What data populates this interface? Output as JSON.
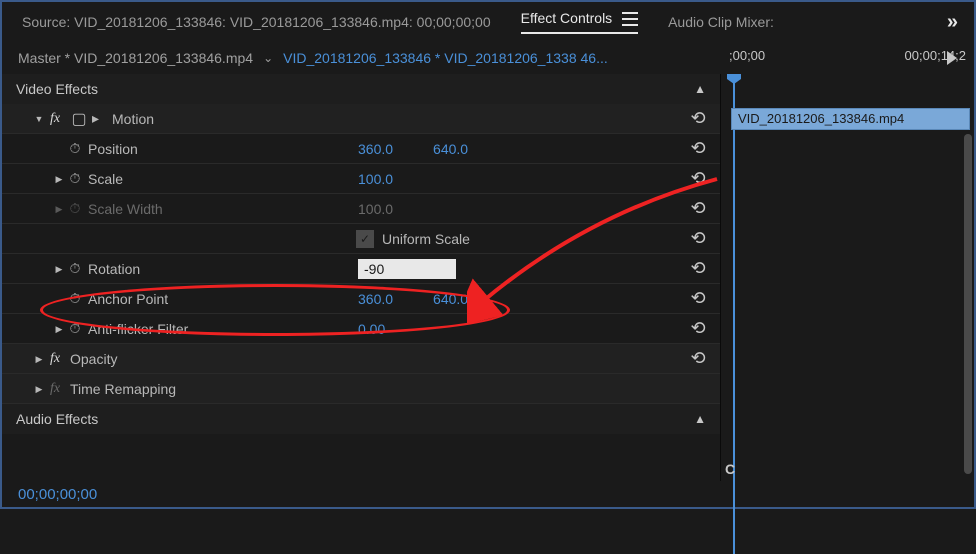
{
  "topTabs": {
    "source": "Source: VID_20181206_133846: VID_20181206_133846.mp4: 00;00;00;00",
    "effectControls": "Effect Controls",
    "audioMixer": "Audio Clip Mixer:"
  },
  "subHeader": {
    "master": "Master * VID_20181206_133846.mp4",
    "sequence": "VID_20181206_133846 * VID_20181206_1338 46..."
  },
  "ruler": {
    "start": ";00;00",
    "end": "00;00;14;2"
  },
  "clip": "VID_20181206_133846.mp4",
  "sections": {
    "video": "Video Effects",
    "audio": "Audio Effects"
  },
  "motion": {
    "label": "Motion",
    "position": {
      "label": "Position",
      "x": "360.0",
      "y": "640.0"
    },
    "scale": {
      "label": "Scale",
      "v": "100.0"
    },
    "scaleWidth": {
      "label": "Scale Width",
      "v": "100.0"
    },
    "uniform": {
      "label": "Uniform Scale"
    },
    "rotation": {
      "label": "Rotation",
      "v": "-90"
    },
    "anchor": {
      "label": "Anchor Point",
      "x": "360.0",
      "y": "640.0"
    },
    "antiflicker": {
      "label": "Anti-flicker Filter",
      "v": "0.00"
    }
  },
  "opacity": {
    "label": "Opacity"
  },
  "timeRemap": {
    "label": "Time Remapping"
  },
  "timecode": "00;00;00;00"
}
